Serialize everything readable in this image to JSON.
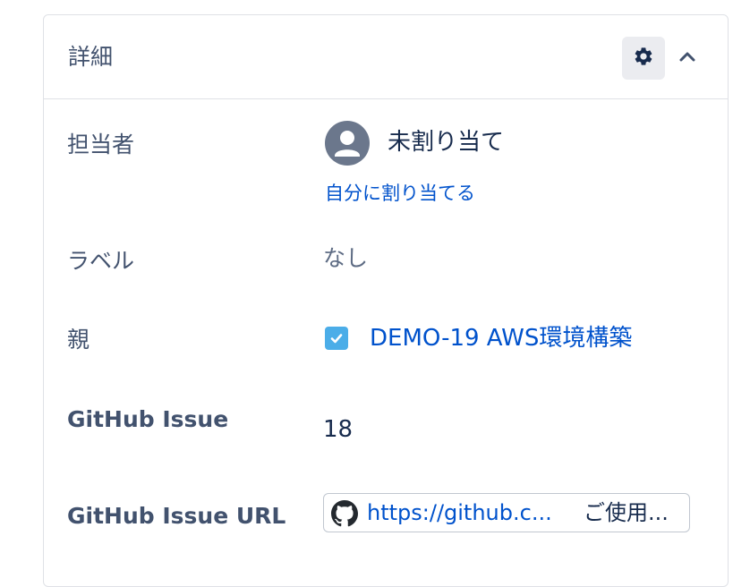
{
  "panel": {
    "title": "詳細"
  },
  "fields": {
    "assignee": {
      "label": "担当者",
      "value": "未割り当て",
      "assign_to_me": "自分に割り当てる"
    },
    "labels": {
      "label": "ラベル",
      "value": "なし"
    },
    "parent": {
      "label": "親",
      "value": "DEMO-19 AWS環境構築"
    },
    "github_issue": {
      "label": "GitHub Issue",
      "value": "18"
    },
    "github_issue_url": {
      "label": "GitHub Issue URL",
      "link_text": "https://github.c...",
      "action_text": "ご使用..."
    }
  },
  "icons": {
    "settings": "gear-icon",
    "collapse": "chevron-up-icon",
    "avatar": "user-avatar-icon",
    "parent_type": "checkbox-task-icon",
    "github": "github-icon"
  },
  "colors": {
    "link": "#0052cc",
    "label_text": "#42526e",
    "primary_text": "#172b4d",
    "muted_text": "#5e6c84",
    "border": "#dfe1e6",
    "button_bg": "#ebecf0",
    "task_icon": "#4bade8",
    "avatar": "#6b778c"
  }
}
